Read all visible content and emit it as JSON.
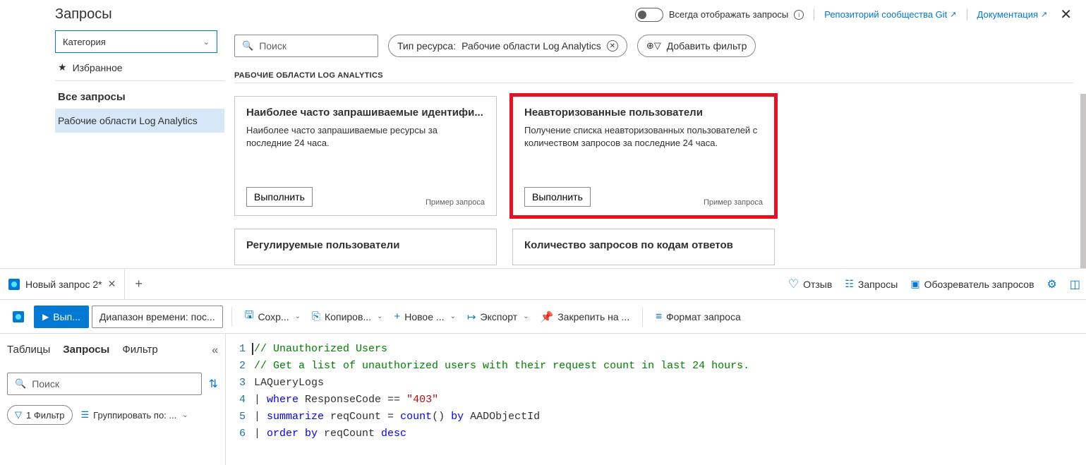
{
  "header": {
    "title": "Запросы",
    "toggle_label": "Всегда отображать запросы",
    "link_git": "Репозиторий сообщества Git",
    "link_docs": "Документация"
  },
  "sidebar": {
    "category_label": "Категория",
    "favorites": "Избранное",
    "all_queries": "Все запросы",
    "items": [
      "Рабочие области Log Analytics"
    ]
  },
  "filters": {
    "search_placeholder": "Поиск",
    "resource_type_label": "Тип ресурса:",
    "resource_type_value": "Рабочие области Log Analytics",
    "add_filter": "Добавить фильтр"
  },
  "section_label": "РАБОЧИЕ ОБЛАСТИ LOG ANALYTICS",
  "cards": [
    {
      "title": "Наиболее часто запрашиваемые идентифи...",
      "desc": "Наиболее часто запрашиваемые ресурсы за последние 24 часа.",
      "run": "Выполнить",
      "tag": "Пример запроса"
    },
    {
      "title": "Неавторизованные пользователи",
      "desc": "Получение списка неавторизованных пользователей с количеством запросов за последние 24 часа.",
      "run": "Выполнить",
      "tag": "Пример запроса",
      "highlight": true
    },
    {
      "title": "Регулируемые пользователи",
      "desc": "",
      "run": "",
      "tag": ""
    },
    {
      "title": "Количество запросов по кодам ответов",
      "desc": "",
      "run": "",
      "tag": ""
    }
  ],
  "tabs": {
    "active": "Новый запрос 2*",
    "links": {
      "feedback": "Отзыв",
      "queries": "Запросы",
      "explorer": "Обозреватель запросов"
    }
  },
  "toolbar": {
    "run": "Вып...",
    "time_range": "Диапазон времени: пос...",
    "save": "Сохр...",
    "copy": "Копиров...",
    "new_rule": "Новое ...",
    "export": "Экспорт",
    "pin": "Закрепить на ...",
    "format": "Формат запроса"
  },
  "left_pane": {
    "tabs": [
      "Таблицы",
      "Запросы",
      "Фильтр"
    ],
    "active_tab": 1,
    "search_placeholder": "Поиск",
    "filter_count": "1 Фильтр",
    "group_by": "Группировать по: ..."
  },
  "code": {
    "lines": [
      {
        "n": 1,
        "type": "comment",
        "text": "// Unauthorized Users"
      },
      {
        "n": 2,
        "type": "comment",
        "text": "// Get a list of unauthorized users with their request count in last 24 hours."
      },
      {
        "n": 3,
        "type": "plain",
        "text": "LAQueryLogs"
      },
      {
        "n": 4,
        "type": "where",
        "kw": "where",
        "rest1": " ResponseCode == ",
        "str": "\"403\""
      },
      {
        "n": 5,
        "type": "summarize",
        "kw": "summarize",
        "rest1": " reqCount = ",
        "func": "count",
        "rest2": "() ",
        "kw2": "by",
        "rest3": " AADObjectId"
      },
      {
        "n": 6,
        "type": "order",
        "kw": "order by",
        "rest1": " reqCount ",
        "kw2": "desc"
      }
    ]
  }
}
